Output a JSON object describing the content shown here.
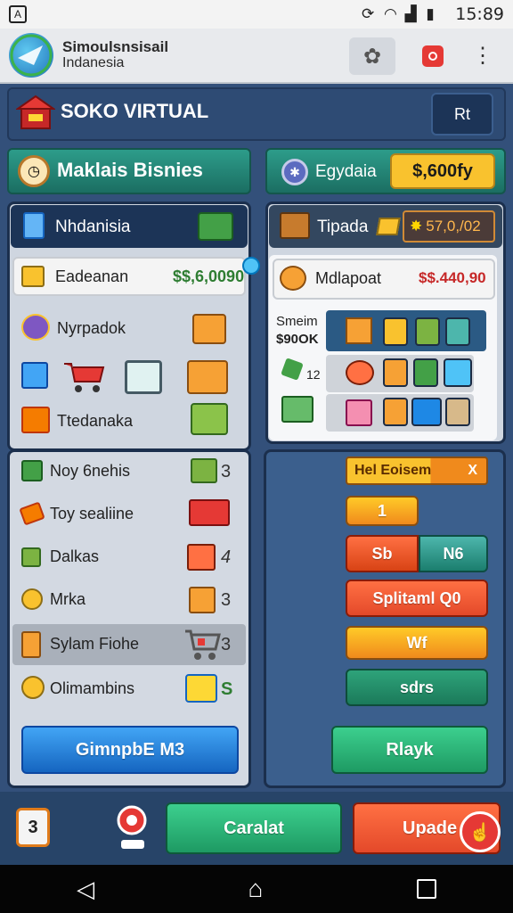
{
  "status_bar": {
    "time": "15:89"
  },
  "app_bar": {
    "title_line1": "Simoulsnsisail",
    "title_line2": "Indanesia"
  },
  "header": {
    "title": "SOKO VIRTUAL",
    "button_label": "Rt"
  },
  "top_left_bar": {
    "label": "Maklais Bisnies"
  },
  "top_right_bar": {
    "label": "Egydaia",
    "value": "$,600fy"
  },
  "left_panel": {
    "header": "Nhdanisia",
    "first_row": {
      "label": "Eadeanan",
      "value": "$$,6,0090"
    },
    "items": [
      {
        "label": "Nyrpadok"
      },
      {
        "label": "Ttedanaka"
      }
    ]
  },
  "right_panel": {
    "header": "Tipada",
    "header_value": "57,0,/02",
    "first_row": {
      "label": "Mdlapoat",
      "value": "$$.440,90"
    },
    "stat_label1": "Smeim",
    "stat_label2": "$90OK",
    "stat_small": "12"
  },
  "left_list": {
    "items": [
      {
        "label": "Noy 6nehis",
        "count": "3"
      },
      {
        "label": "Toy sealiine",
        "count": ""
      },
      {
        "label": "Dalkas",
        "count": "4"
      },
      {
        "label": "Mrka",
        "count": "3"
      },
      {
        "label": "Sylam Fiohe",
        "count": "3"
      },
      {
        "label": "Olimambins",
        "count": "S"
      }
    ],
    "button_label": "GimnpbE M3"
  },
  "right_actions": {
    "tag_label": "Hel Eoisem",
    "tag_x": "X",
    "btn1": "1",
    "btn2a": "Sb",
    "btn2b": "N6",
    "btn3": "Splitaml Q0",
    "btn4": "Wf",
    "btn5": "sdrs",
    "btn6": "Rlayk"
  },
  "bottom_bar": {
    "badge": "3",
    "green_button": "Caralat",
    "red_button": "Upade"
  },
  "colors": {
    "navy": "#1c3457",
    "teal": "#1f8b78",
    "orange": "#f08a1c",
    "red": "#e4492a",
    "green": "#27b36d",
    "blue": "#1e88e5"
  }
}
